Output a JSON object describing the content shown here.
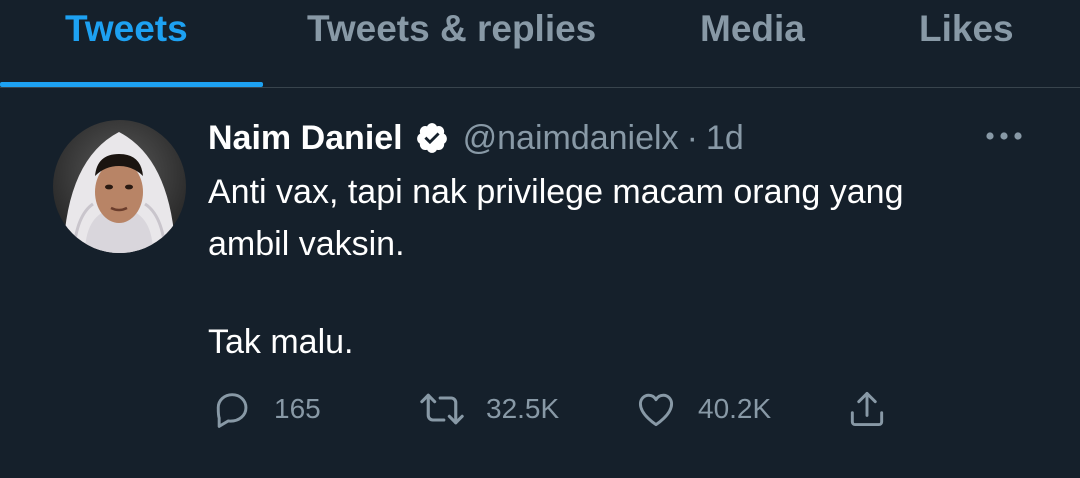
{
  "tabs": {
    "items": [
      {
        "label": "Tweets",
        "active": true
      },
      {
        "label": "Tweets & replies",
        "active": false
      },
      {
        "label": "Media",
        "active": false
      },
      {
        "label": "Likes",
        "active": false
      }
    ]
  },
  "tweet": {
    "author_name": "Naim Daniel",
    "verified": true,
    "handle": "@naimdanielx",
    "separator": "·",
    "time": "1d",
    "lines": [
      "Anti vax, tapi nak privilege macam orang yang",
      "ambil vaksin.",
      "",
      "Tak malu."
    ],
    "actions": {
      "reply_count": "165",
      "retweet_count": "32.5K",
      "like_count": "40.2K"
    }
  },
  "icons": {
    "verified": "verified-badge-icon",
    "more": "more-dots-icon",
    "reply": "reply-icon",
    "retweet": "retweet-icon",
    "like": "heart-icon",
    "share": "share-icon"
  },
  "colors": {
    "background": "#15202b",
    "accent": "#1da1f2",
    "secondary_text": "#8899a6",
    "divider": "#38444d"
  }
}
